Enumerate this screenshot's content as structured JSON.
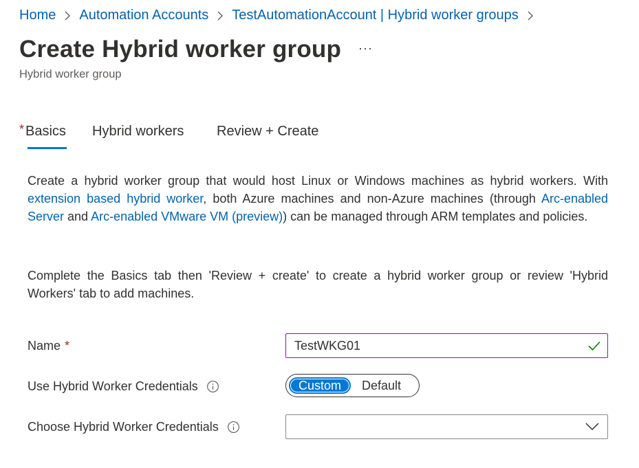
{
  "breadcrumb": {
    "items": [
      "Home",
      "Automation Accounts",
      "TestAutomationAccount | Hybrid worker groups"
    ]
  },
  "header": {
    "title": "Create Hybrid worker group",
    "more": "···",
    "subtitle": "Hybrid worker group"
  },
  "tabs": {
    "basics": {
      "label": "Basics",
      "required_marker": "*"
    },
    "hybrid_workers": {
      "label": "Hybrid workers"
    },
    "review_create": {
      "label": "Review + Create"
    }
  },
  "description": {
    "p1_a": "Create a hybrid worker group that would host Linux or Windows machines as hybrid workers. With ",
    "link1": "extension based hybrid worker",
    "p1_b": ", both Azure machines and non-Azure machines (through ",
    "link2": "Arc-enabled Server",
    "p1_c": " and ",
    "link3": "Arc-enabled VMware VM (preview)",
    "p1_d": ") can be managed through ARM templates and policies.",
    "p2": "Complete the Basics tab then 'Review + create' to create a hybrid worker group or review 'Hybrid Workers' tab to add machines."
  },
  "form": {
    "name": {
      "label": "Name",
      "required_marker": "*",
      "value": "TestWKG01"
    },
    "use_credentials": {
      "label": "Use Hybrid Worker Credentials",
      "options": [
        "Custom",
        "Default"
      ],
      "selected": "Custom"
    },
    "choose_credentials": {
      "label": "Choose Hybrid Worker Credentials",
      "value": ""
    }
  },
  "colors": {
    "link": "#0063b1",
    "accent": "#0078d4",
    "required": "#a4262c",
    "valid_check": "#107c10",
    "input_focus_border": "#881798"
  }
}
